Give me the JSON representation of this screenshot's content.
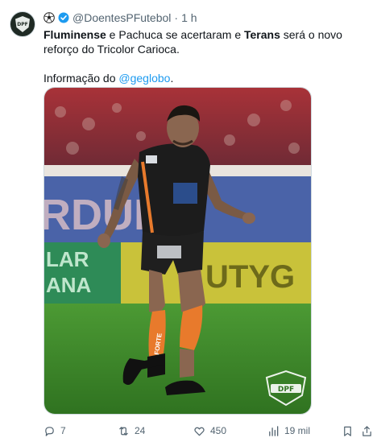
{
  "account": {
    "handle": "@DoentesPFutebol",
    "time": "1 h",
    "avatar_text": "DPF"
  },
  "tweet": {
    "club1": "Fluminense",
    "t1": " e Pachuca se acertaram e ",
    "player": "Terans",
    "t2": " será o novo reforço do Tricolor Carioca.",
    "source_prefix": "Informação do ",
    "mention": "@geglobo",
    "source_suffix": "."
  },
  "media": {
    "watermark": "DPF",
    "ad_text_1": "RDUN",
    "ad_text_2": "LAR",
    "ad_text_3": "ANA",
    "ad_text_4": "UTYG",
    "jersey_text": "FORTE"
  },
  "actions": {
    "replies": "7",
    "retweets": "24",
    "likes": "450",
    "views": "19 mil"
  },
  "colors": {
    "verified": "#1d9bf0",
    "link": "#1d9bf0",
    "muted": "#536471",
    "pitch": "#3f8a2a",
    "jersey": "#1c1c1c",
    "accent": "#e87a2c"
  }
}
